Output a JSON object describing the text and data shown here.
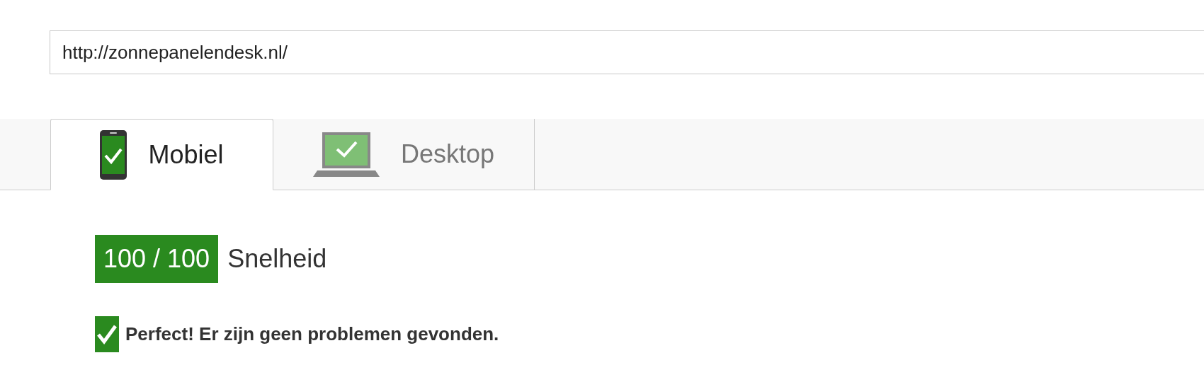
{
  "url_field": {
    "value": "http://zonnepanelendesk.nl/"
  },
  "tabs": [
    {
      "label": "Mobiel",
      "kind": "phone",
      "selected": true
    },
    {
      "label": "Desktop",
      "kind": "laptop",
      "selected": false
    }
  ],
  "score": {
    "value": "100 / 100",
    "label": "Snelheid"
  },
  "result": {
    "text": "Perfect! Er zijn geen problemen gevonden."
  }
}
